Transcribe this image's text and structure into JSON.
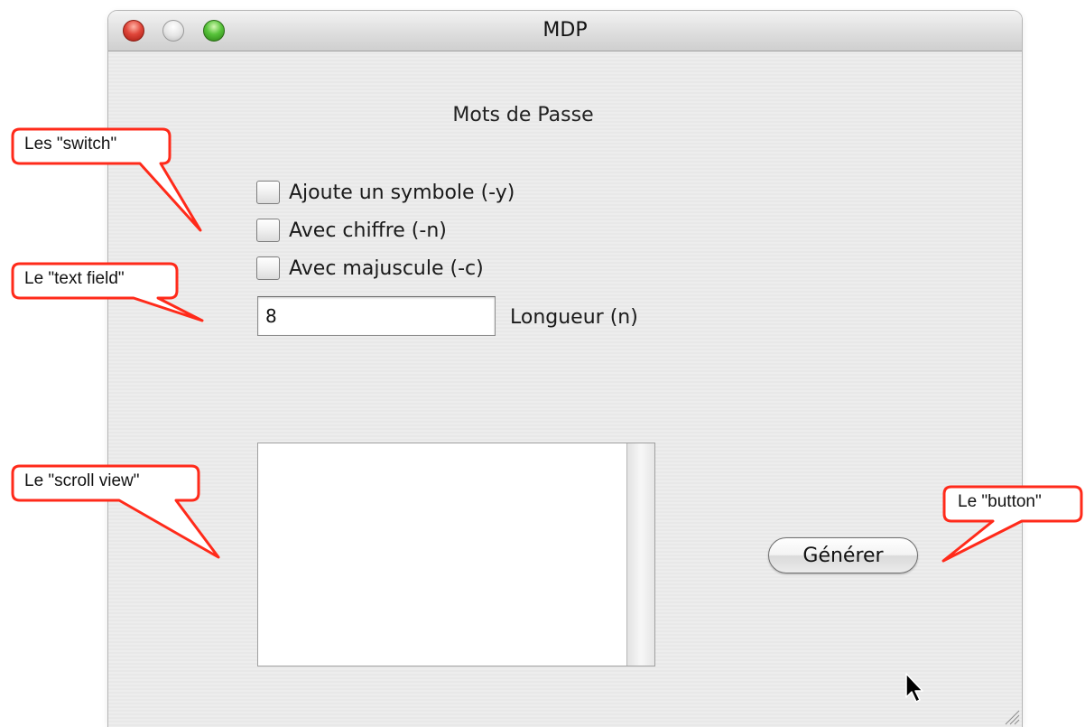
{
  "window": {
    "title": "MDP"
  },
  "content": {
    "heading": "Mots de Passe",
    "options": [
      {
        "label": "Ajoute un symbole (-y)",
        "checked": false
      },
      {
        "label": "Avec chiffre (-n)",
        "checked": false
      },
      {
        "label": "Avec majuscule (-c)",
        "checked": false
      }
    ],
    "length_field": {
      "value": "8",
      "label": "Longueur (n)"
    },
    "generate_button": "Générer"
  },
  "annotations": {
    "switch": "Les \"switch\"",
    "text_field": "Le \"text field\"",
    "scroll_view": "Le \"scroll view\"",
    "button": "Le \"button\""
  },
  "colors": {
    "callout_border": "#ff2a1a"
  }
}
